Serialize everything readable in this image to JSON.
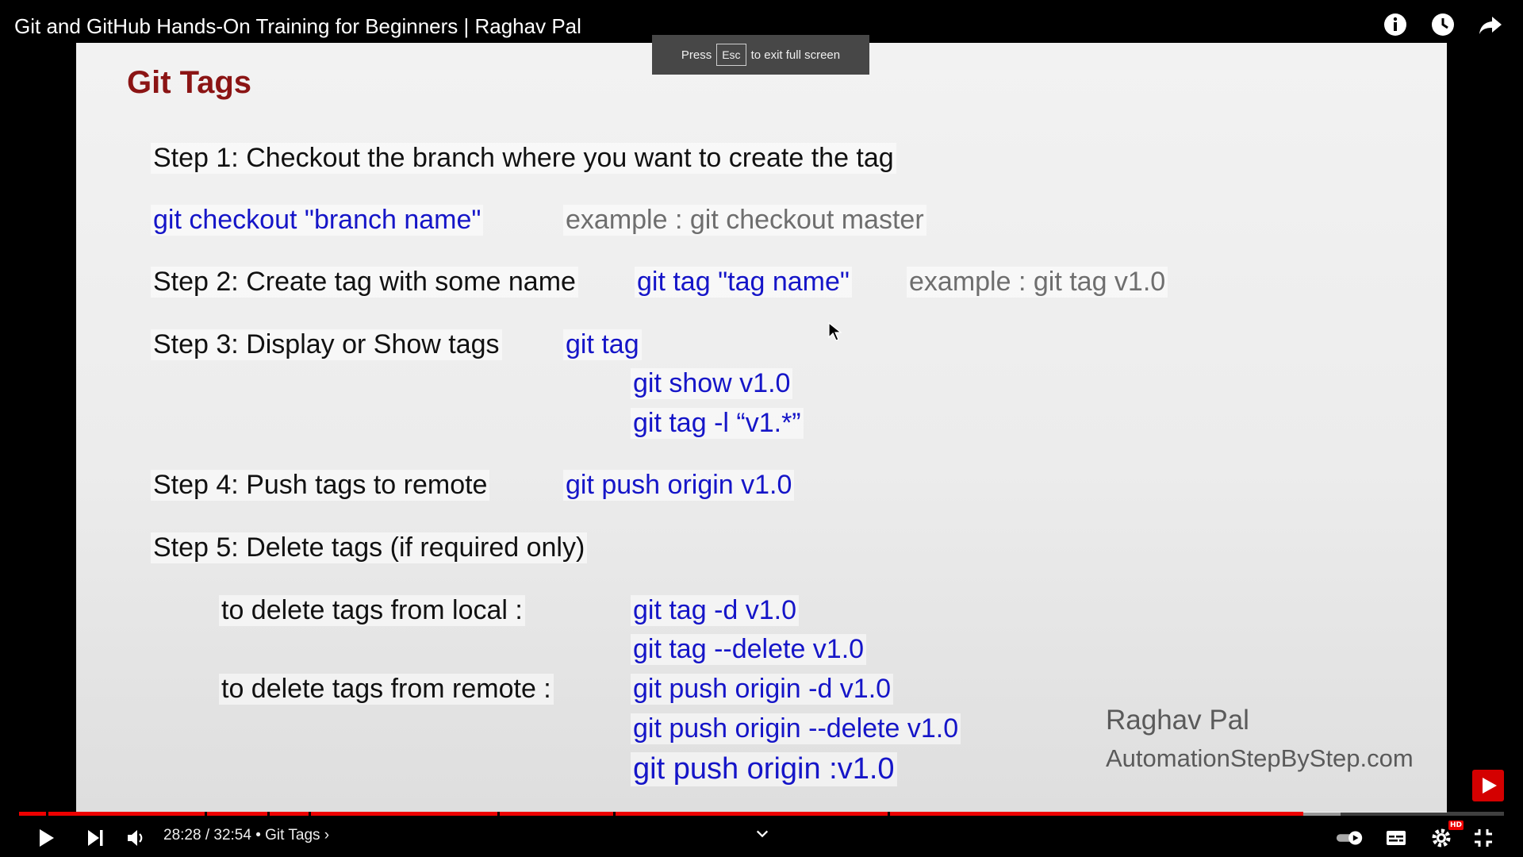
{
  "video": {
    "title": "Git and GitHub Hands-On Training for Beginners | Raghav Pal",
    "current_time": "28:28 / 32:54",
    "chapter": "Git Tags",
    "progress_fraction": 0.865,
    "buffer_fraction": 0.89,
    "chapter_separators_fraction": [
      0.018,
      0.125,
      0.167,
      0.195,
      0.322,
      0.4,
      0.585
    ]
  },
  "toast": {
    "press": "Press",
    "key": "Esc",
    "rest": "to exit full screen"
  },
  "slide": {
    "title": "Git Tags",
    "step1": "Step 1: Checkout the branch where you want to create the tag",
    "step1_cmd": "git checkout \"branch name\"",
    "step1_example": "example : git checkout master",
    "step2": "Step 2: Create tag with some name",
    "step2_cmd": "git tag \"tag name\"",
    "step2_example": "example : git tag v1.0",
    "step3": "Step 3: Display or Show tags",
    "step3_cmd1": "git tag",
    "step3_cmd2": "git show v1.0",
    "step3_cmd3": "git tag -l “v1.*”",
    "step4": "Step 4: Push tags to remote",
    "step4_cmd": "git push origin v1.0",
    "step5": "Step 5: Delete tags (if required only)",
    "local_label": "to delete tags from local :",
    "local_cmd1": "git tag -d v1.0",
    "local_cmd2": "git tag --delete v1.0",
    "remote_label": "to delete tags from remote :",
    "remote_cmd1": "git push origin -d v1.0",
    "remote_cmd2": "git push origin --delete v1.0",
    "remote_cmd3": "git push origin :v1.0",
    "author": "Raghav Pal",
    "site": "AutomationStepByStep.com"
  },
  "icons": {
    "info": "info-icon",
    "watch_later": "clock-icon",
    "share": "share-icon",
    "play": "play-icon",
    "next": "skip-next-icon",
    "volume": "volume-icon",
    "autoplay": "autoplay-toggle-icon",
    "captions": "subtitles-icon",
    "settings": "gear-icon",
    "fullscreen_exit": "exit-fullscreen-icon"
  },
  "colors": {
    "progress": "#e00000",
    "slide_title": "#8b1414",
    "command": "#1515c8",
    "example": "#6e6e6e"
  }
}
